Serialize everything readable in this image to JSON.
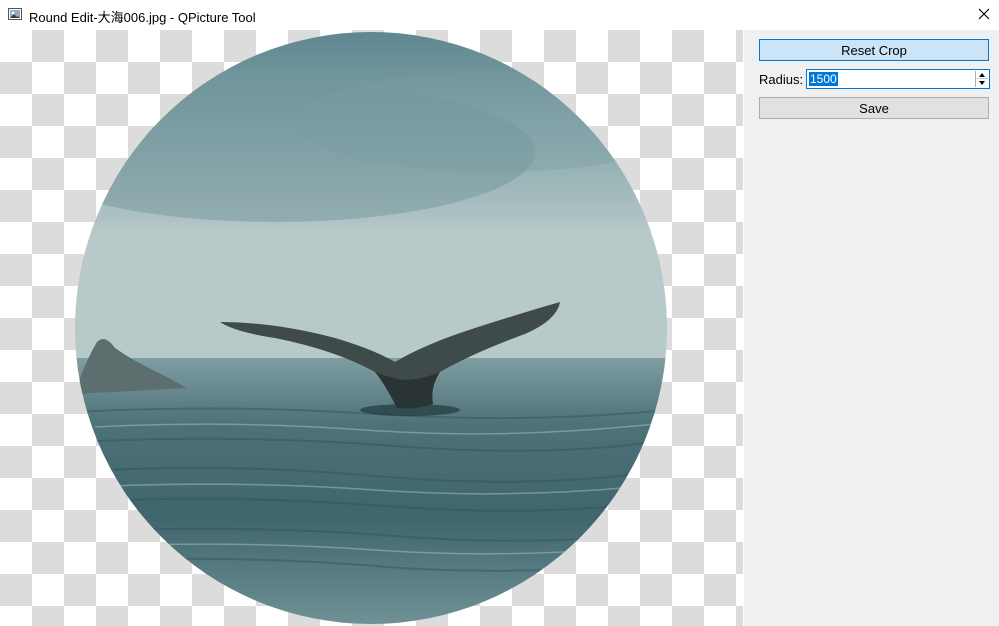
{
  "window": {
    "title": "Round Edit-大海006.jpg - QPicture Tool",
    "app_icon": "picture-icon",
    "close_icon": "close-icon"
  },
  "panel": {
    "reset_label": "Reset Crop",
    "radius_label": "Radius:",
    "radius_value": "1500",
    "save_label": "Save"
  },
  "colors": {
    "accent": "#0078d7",
    "panel_bg": "#f0f0f0",
    "checker": "#dcdcdc"
  }
}
